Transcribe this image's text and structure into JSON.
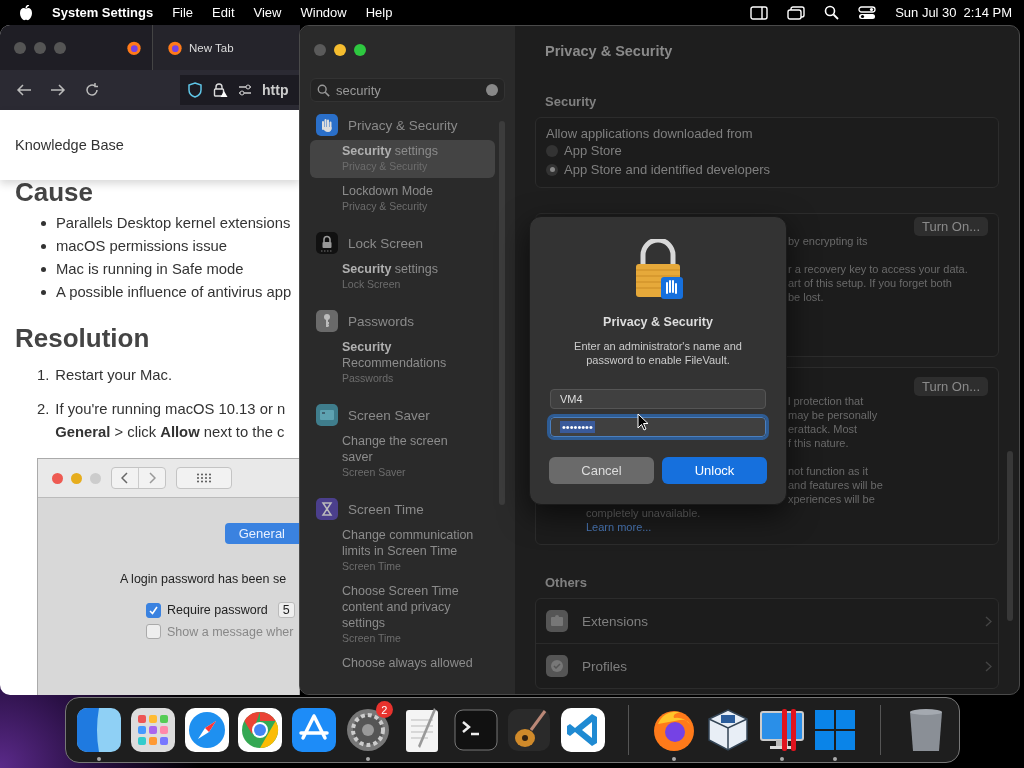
{
  "menu_bar": {
    "app_name": "System Settings",
    "menus": [
      "File",
      "Edit",
      "View",
      "Window",
      "Help"
    ],
    "date": "Sun Jul 30",
    "time": "2:14 PM"
  },
  "browser": {
    "tabs": [
      {
        "kind": "pinned",
        "selected": false
      },
      {
        "kind": "page",
        "label": "New Tab",
        "selected": true
      }
    ],
    "address": "http",
    "page": {
      "header": "Knowledge Base",
      "cause_heading": "Cause",
      "causes": [
        "Parallels Desktop kernel extensions",
        "macOS permissions issue",
        "Mac is running in Safe mode",
        "A possible influence of antivirus app"
      ],
      "resolution_heading": "Resolution",
      "steps": [
        {
          "number": "1.",
          "lines": [
            "Restart your Mac."
          ]
        },
        {
          "number": "2.",
          "lines": [
            "If you're running macOS 10.13 or n",
            "**General** > click **Allow** next to the c"
          ]
        }
      ],
      "figure": {
        "tab": "General",
        "message": "A login password has been se",
        "options": [
          {
            "label": "Require password",
            "checked": true,
            "value": "5"
          },
          {
            "label": "Show a message wher",
            "checked": false
          }
        ]
      }
    }
  },
  "settings": {
    "title": "Privacy & Security",
    "search": "security",
    "results": [
      {
        "kind": "hand",
        "title": "Privacy & Security",
        "items": [
          {
            "title": "**Security** settings",
            "subtitle": "Privacy & Security",
            "selected": true
          },
          {
            "title": "Lockdown Mode",
            "subtitle": "Privacy & Security",
            "selected": false
          }
        ]
      },
      {
        "kind": "lock",
        "title": "Lock Screen",
        "items": [
          {
            "title": "**Security** settings",
            "subtitle": "Lock Screen",
            "selected": false
          }
        ]
      },
      {
        "kind": "key",
        "title": "Passwords",
        "items": [
          {
            "title": "**Security** Recommendations",
            "subtitle": "Passwords",
            "selected": false
          }
        ]
      },
      {
        "kind": "screen",
        "title": "Screen Saver",
        "items": [
          {
            "title": "Change the screen saver",
            "subtitle": "Screen Saver",
            "selected": false
          }
        ]
      },
      {
        "kind": "hourglass",
        "title": "Screen Time",
        "items": [
          {
            "title": "Change communication limits in Screen Time",
            "subtitle": "Screen Time",
            "selected": false
          },
          {
            "title": "Choose Screen Time content and privacy settings",
            "subtitle": "Screen Time",
            "selected": false
          },
          {
            "title": "Choose always allowed",
            "selected": false
          }
        ]
      }
    ],
    "security": {
      "heading": "Security",
      "prompt": "Allow applications downloaded from",
      "options": [
        {
          "label": "App Store",
          "selected": false
        },
        {
          "label": "App Store and identified developers",
          "selected": true
        }
      ]
    },
    "filevault": {
      "button": "Turn On...",
      "fragments": [
        [
          "by encrypting its"
        ],
        [
          "r a recovery key to access your data.",
          "art of this setup. If you forget both",
          "be lost."
        ]
      ]
    },
    "lockdown": {
      "button": "Turn On...",
      "fragments": [
        [
          "l protection that",
          "may be personally",
          "erattack. Most",
          "f this nature."
        ],
        [
          "not function as it",
          "and features will be",
          "xperiences will be"
        ]
      ],
      "text": "completely unavailable.",
      "link": "Learn more..."
    },
    "others": {
      "heading": "Others",
      "rows": [
        {
          "kind": "extensions",
          "label": "Extensions"
        },
        {
          "kind": "profiles",
          "label": "Profiles"
        }
      ]
    },
    "dialog": {
      "title": "Privacy & Security",
      "message": "Enter an administrator's name and password to enable FileVault.",
      "username": "VM4",
      "password": "••••••••",
      "buttons": [
        {
          "label": "Cancel",
          "default": false
        },
        {
          "label": "Unlock",
          "default": true
        }
      ]
    }
  },
  "dock": {
    "items": [
      {
        "kind": "finder",
        "running": true
      },
      {
        "kind": "launchpad",
        "running": false
      },
      {
        "kind": "safari",
        "running": false
      },
      {
        "kind": "chrome",
        "running": false
      },
      {
        "kind": "appstore",
        "running": false
      },
      {
        "kind": "settings",
        "running": true,
        "badge": "2"
      },
      {
        "kind": "textedit",
        "running": false
      },
      {
        "kind": "terminal",
        "running": false
      },
      {
        "kind": "guitar",
        "running": false
      },
      {
        "kind": "vscode",
        "running": false
      },
      {
        "kind": "separator"
      },
      {
        "kind": "firefox",
        "running": true
      },
      {
        "kind": "virtualbox",
        "running": false
      },
      {
        "kind": "parallels",
        "running": true
      },
      {
        "kind": "windows",
        "running": true
      },
      {
        "kind": "separator"
      },
      {
        "kind": "trash",
        "running": false
      }
    ]
  }
}
